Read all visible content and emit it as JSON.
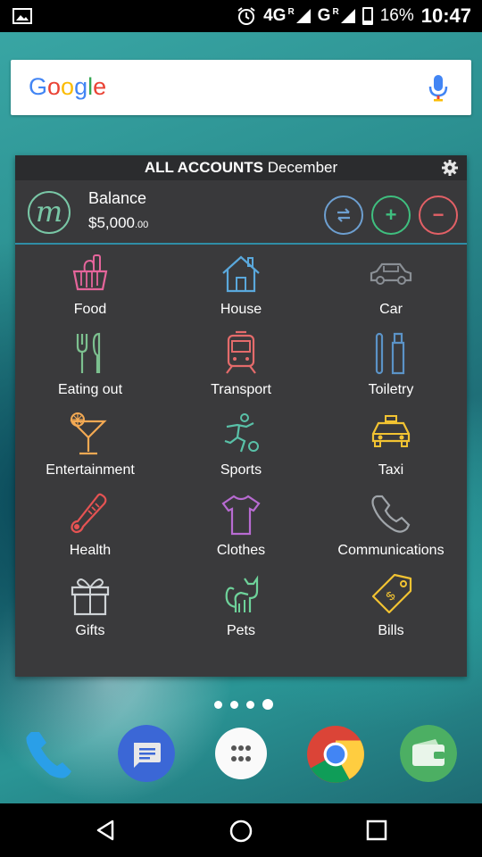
{
  "status_bar": {
    "network1": "4G",
    "network1_sup": "R",
    "network2": "G",
    "network2_sup": "R",
    "battery": "16%",
    "time": "10:47"
  },
  "search": {
    "logo_letters": [
      "G",
      "o",
      "o",
      "g",
      "l",
      "e"
    ],
    "logo_colors": [
      "#4285F4",
      "#EA4335",
      "#FBBC05",
      "#4285F4",
      "#34A853",
      "#EA4335"
    ]
  },
  "widget": {
    "header_bold": "ALL ACCOUNTS",
    "header_month": "December",
    "logo_letter": "m",
    "balance_label": "Balance",
    "balance_amount": "$5,000",
    "balance_cents": ".00",
    "plus_label": "+",
    "minus_label": "−",
    "categories": [
      {
        "label": "Food",
        "icon": "food-basket-icon",
        "color": "#e5659b"
      },
      {
        "label": "House",
        "icon": "house-icon",
        "color": "#5aa8dc"
      },
      {
        "label": "Car",
        "icon": "car-icon",
        "color": "#8a8f95"
      },
      {
        "label": "Eating out",
        "icon": "fork-knife-icon",
        "color": "#7cc08f"
      },
      {
        "label": "Transport",
        "icon": "train-icon",
        "color": "#e46b6b"
      },
      {
        "label": "Toiletry",
        "icon": "toothbrush-icon",
        "color": "#5b93c7"
      },
      {
        "label": "Entertainment",
        "icon": "cocktail-icon",
        "color": "#f3a953"
      },
      {
        "label": "Sports",
        "icon": "soccer-player-icon",
        "color": "#59c1a8"
      },
      {
        "label": "Taxi",
        "icon": "taxi-icon",
        "color": "#f2c332"
      },
      {
        "label": "Health",
        "icon": "thermometer-icon",
        "color": "#e55353"
      },
      {
        "label": "Clothes",
        "icon": "tshirt-icon",
        "color": "#b86bd2"
      },
      {
        "label": "Communications",
        "icon": "phone-icon",
        "color": "#a0a5aa"
      },
      {
        "label": "Gifts",
        "icon": "gift-icon",
        "color": "#cfd3d6"
      },
      {
        "label": "Pets",
        "icon": "cat-icon",
        "color": "#6ed29a"
      },
      {
        "label": "Bills",
        "icon": "price-tag-icon",
        "color": "#f2c332"
      }
    ]
  },
  "dock": [
    {
      "name": "phone",
      "icon": "phone-app-icon"
    },
    {
      "name": "messages",
      "icon": "messages-app-icon"
    },
    {
      "name": "app-drawer",
      "icon": "app-drawer-icon"
    },
    {
      "name": "chrome",
      "icon": "chrome-icon"
    },
    {
      "name": "wallet",
      "icon": "wallet-app-icon"
    }
  ],
  "page_indicator": {
    "pages": 4,
    "current": 4
  }
}
